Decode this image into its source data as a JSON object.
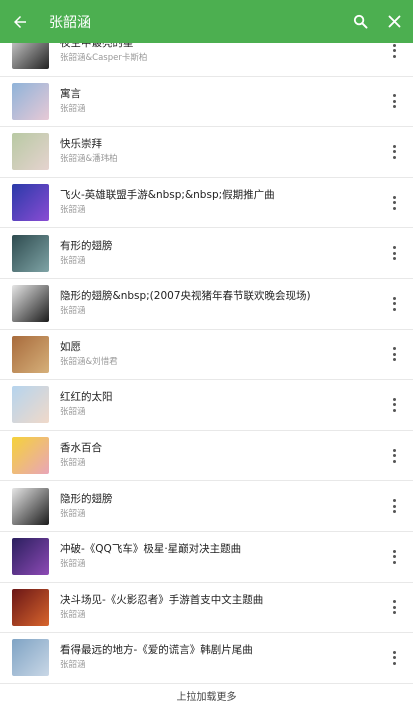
{
  "theme": {
    "accent": "#4caf50"
  },
  "appbar": {
    "back_icon": "arrow-left-icon",
    "title": "张韶涵",
    "search_icon": "search-icon",
    "close_icon": "close-icon"
  },
  "songs": [
    {
      "title": "夜空中最亮的星",
      "artist": "张韶涵&Casper卡斯柏",
      "cover_color": "#d9d9d9",
      "cover_color2": "#222222"
    },
    {
      "title": "寓言",
      "artist": "张韶涵",
      "cover_color": "#8fb3d9",
      "cover_color2": "#e7c9d6"
    },
    {
      "title": "快乐崇拜",
      "artist": "张韶涵&潘玮柏",
      "cover_color": "#b8c9a3",
      "cover_color2": "#e5d3cf"
    },
    {
      "title": "飞火-英雄联盟手游&nbsp;&nbsp;假期推广曲",
      "artist": "张韶涵",
      "cover_color": "#2a3aa8",
      "cover_color2": "#8a4cd4"
    },
    {
      "title": "有形的翅膀",
      "artist": "张韶涵",
      "cover_color": "#2e4b4f",
      "cover_color2": "#7fa4a6"
    },
    {
      "title": "隐形的翅膀&nbsp;(2007央视猪年春节联欢晚会现场)",
      "artist": "张韶涵",
      "cover_color": "#e6e6e6",
      "cover_color2": "#1b1b1b"
    },
    {
      "title": "如愿",
      "artist": "张韶涵&刘惜君",
      "cover_color": "#a86b3c",
      "cover_color2": "#d6b07a"
    },
    {
      "title": "红红的太阳",
      "artist": "张韶涵",
      "cover_color": "#b5d4ee",
      "cover_color2": "#f0d9c9"
    },
    {
      "title": "香水百合",
      "artist": "张韶涵",
      "cover_color": "#f5d23a",
      "cover_color2": "#e9a5b8"
    },
    {
      "title": "隐形的翅膀",
      "artist": "张韶涵",
      "cover_color": "#e6e6e6",
      "cover_color2": "#1b1b1b"
    },
    {
      "title": "冲破-《QQ飞车》极星·星巅对决主题曲",
      "artist": "张韶涵",
      "cover_color": "#2a1f5e",
      "cover_color2": "#8d4ab5"
    },
    {
      "title": "决斗场见-《火影忍者》手游首支中文主题曲",
      "artist": "张韶涵",
      "cover_color": "#6a1616",
      "cover_color2": "#d8652d"
    },
    {
      "title": "看得最远的地方-《爱的谎言》韩剧片尾曲",
      "artist": "张韶涵",
      "cover_color": "#7fa3c4",
      "cover_color2": "#c9d7e6"
    }
  ],
  "more_icon": "more-vertical-icon",
  "footer": {
    "load_more": "上拉加载更多"
  }
}
